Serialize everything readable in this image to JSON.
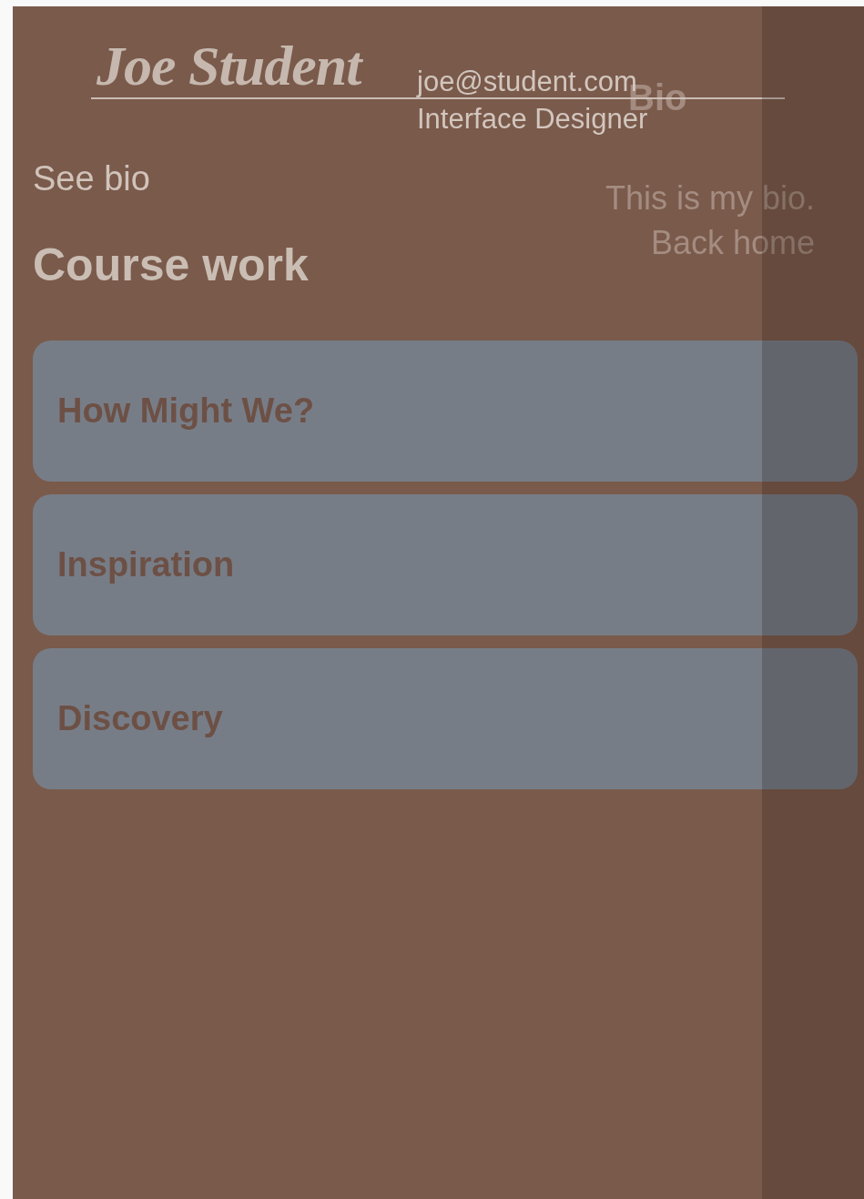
{
  "profile": {
    "name": "Joe Student",
    "email": "joe@student.com",
    "role": "Interface Designer"
  },
  "bio_panel": {
    "title": "Bio",
    "text": "This is my bio.",
    "back_link": "Back home"
  },
  "see_bio_link": "See bio",
  "section_title": "Course work",
  "courses": [
    {
      "title": "How Might We?"
    },
    {
      "title": "Inspiration"
    },
    {
      "title": "Discovery"
    }
  ]
}
